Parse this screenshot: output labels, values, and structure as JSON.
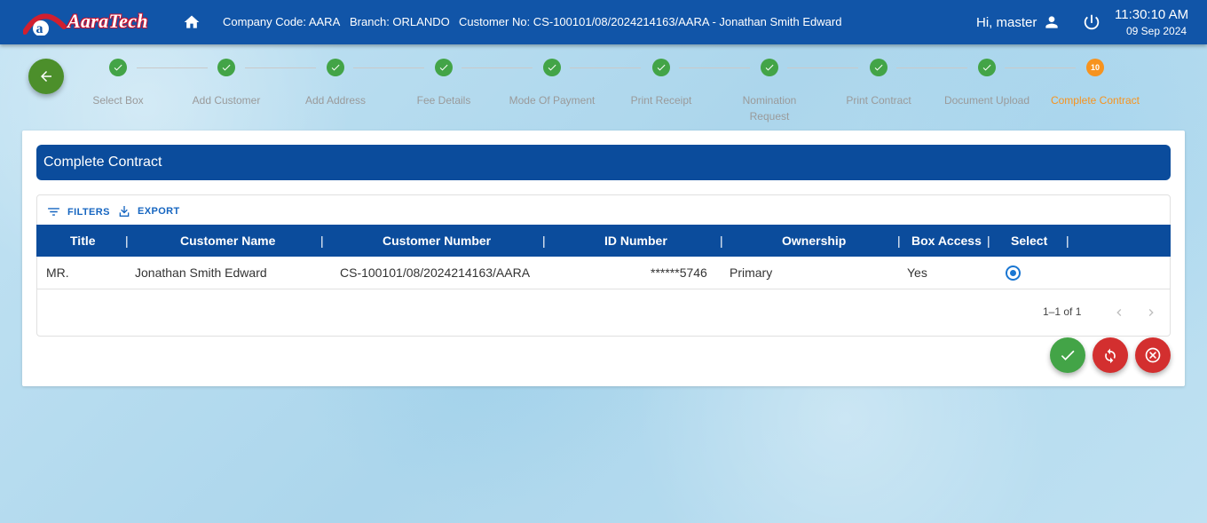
{
  "header": {
    "logo_text": "AaraTech",
    "company_code": "Company Code: AARA",
    "branch": "Branch: ORLANDO",
    "customer_no": "Customer No: CS-100101/08/2024214163/AARA - Jonathan Smith Edward",
    "greeting": "Hi, master",
    "time": "11:30:10 AM",
    "date": "09 Sep 2024",
    "colors": {
      "bar": "#1155a8"
    }
  },
  "stepper": {
    "steps": [
      {
        "label": "Select Box",
        "status": "done"
      },
      {
        "label": "Add Customer",
        "status": "done"
      },
      {
        "label": "Add Address",
        "status": "done"
      },
      {
        "label": "Fee Details",
        "status": "done"
      },
      {
        "label": "Mode Of Payment",
        "status": "done"
      },
      {
        "label": "Print Receipt",
        "status": "done"
      },
      {
        "label": "Nomination Request",
        "status": "done"
      },
      {
        "label": "Print Contract",
        "status": "done"
      },
      {
        "label": "Document Upload",
        "status": "done"
      },
      {
        "label": "Complete Contract",
        "status": "current",
        "number": "10"
      }
    ],
    "colors": {
      "done": "#43a447",
      "current": "#f7931e"
    }
  },
  "card": {
    "title": "Complete Contract",
    "toolbar": {
      "filters_label": "FILTERS",
      "export_label": "EXPORT"
    },
    "columns": [
      "Title",
      "Customer Name",
      "Customer Number",
      "ID Number",
      "Ownership",
      "Box Access",
      "Select"
    ],
    "rows": [
      {
        "title": "MR.",
        "customer_name": "Jonathan Smith Edward",
        "customer_number": "CS-100101/08/2024214163/AARA",
        "id_number": "******5746",
        "ownership": "Primary",
        "box_access": "Yes",
        "selected": true
      }
    ],
    "pagination": "1–1 of 1"
  },
  "actions": {
    "confirm_icon": "check-icon",
    "refresh_icon": "refresh-icon",
    "cancel_icon": "cancel-icon"
  }
}
